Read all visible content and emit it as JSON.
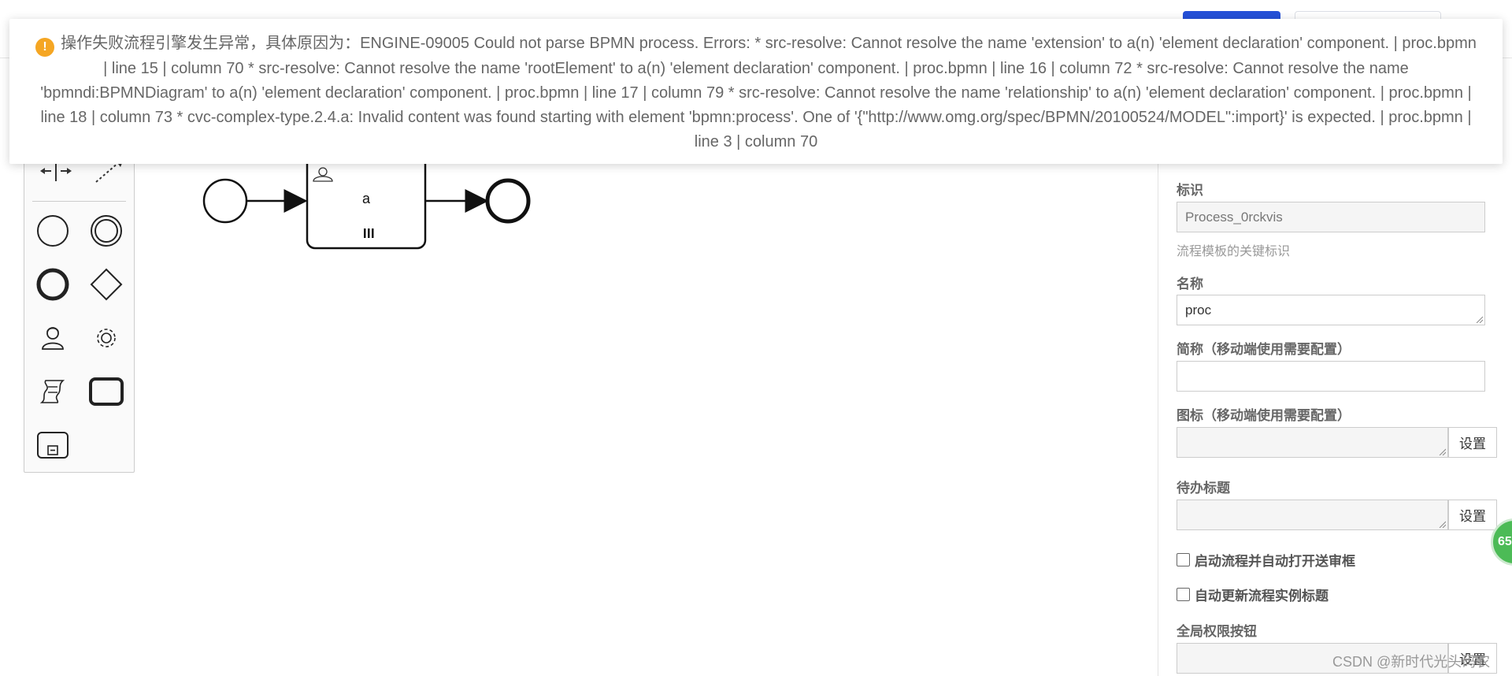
{
  "toast": {
    "message": "操作失败流程引擎发生异常，具体原因为：ENGINE-09005 Could not parse BPMN process. Errors: * src-resolve: Cannot resolve the name 'extension' to a(n) 'element declaration' component. | proc.bpmn | line 15 | column 70 * src-resolve: Cannot resolve the name 'rootElement' to a(n) 'element declaration' component. | proc.bpmn | line 16 | column 72 * src-resolve: Cannot resolve the name 'bpmndi:BPMNDiagram' to a(n) 'element declaration' component. | proc.bpmn | line 17 | column 79 * src-resolve: Cannot resolve the name 'relationship' to a(n) 'element declaration' component. | proc.bpmn | line 18 | column 73 * cvc-complex-type.2.4.a: Invalid content was found starting with element 'bpmn:process'. One of '{\"http://www.omg.org/spec/BPMN/20100524/MODEL\":import}' is expected. | proc.bpmn | line 3 | column 70",
    "icon": "warning-icon"
  },
  "diagram": {
    "task_label": "a"
  },
  "palette": {
    "tools": [
      "space-tool-icon",
      "connect-tool-icon",
      "start-event-icon",
      "intermediate-event-icon",
      "end-event-icon",
      "gateway-icon",
      "user-task-icon",
      "service-task-icon",
      "script-task-icon",
      "task-icon",
      "subprocess-icon"
    ]
  },
  "props": {
    "id_label": "标识",
    "id_value": "Process_0rckvis",
    "id_hint": "流程模板的关键标识",
    "name_label": "名称",
    "name_value": "proc",
    "short_label": "简称（移动端使用需要配置）",
    "short_value": "",
    "icon_label": "图标（移动端使用需要配置）",
    "todo_label": "待办标题",
    "set_label": "设置",
    "check1": "启动流程并自动打开送审框",
    "check2": "自动更新流程实例标题",
    "global_label": "全局权限按钮"
  },
  "badge": {
    "text": "65"
  },
  "watermark": "CSDN @新时代光头码农"
}
